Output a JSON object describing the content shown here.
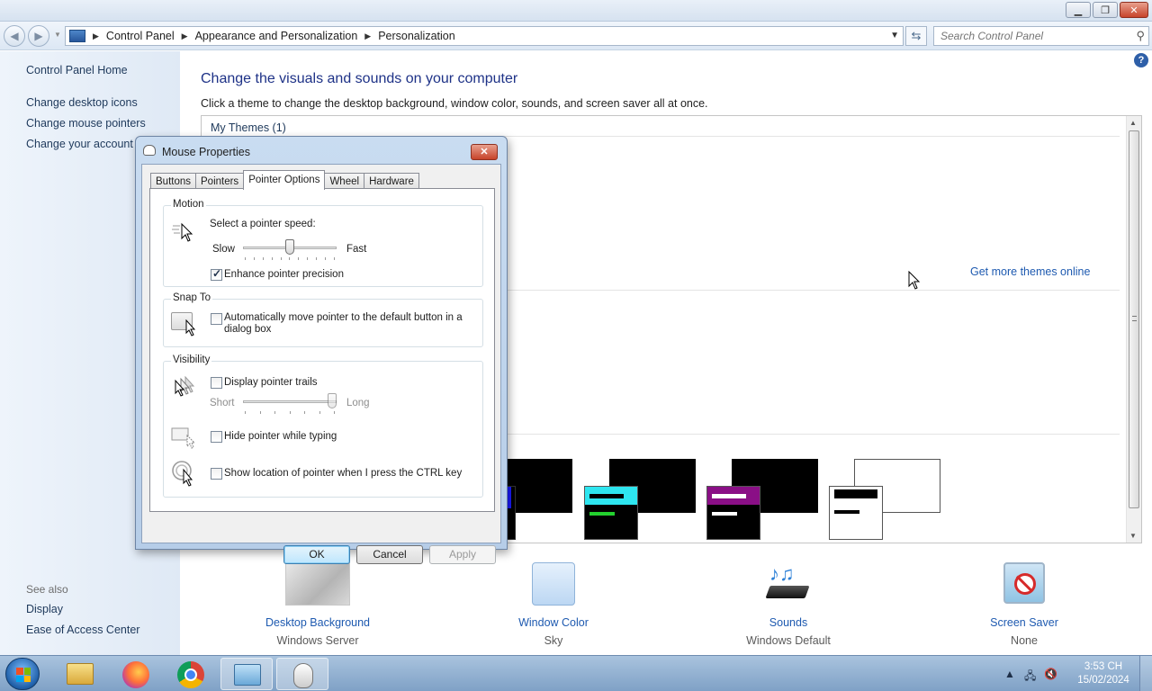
{
  "address": {
    "crumbs": [
      "Control Panel",
      "Appearance and Personalization",
      "Personalization"
    ],
    "search_placeholder": "Search Control Panel"
  },
  "sidebar": {
    "home": "Control Panel Home",
    "links": [
      "Change desktop icons",
      "Change mouse pointers",
      "Change your account p"
    ],
    "see_also_label": "See also",
    "see_also": [
      "Display",
      "Ease of Access Center"
    ]
  },
  "main": {
    "title": "Change the visuals and sounds on your computer",
    "description": "Click a theme to change the desktop background, window color, sounds, and screen saver all at once.",
    "my_themes": "My Themes (1)",
    "get_more": "Get more themes online"
  },
  "options": [
    {
      "label": "Desktop Background",
      "value": "Windows Server"
    },
    {
      "label": "Window Color",
      "value": "Sky"
    },
    {
      "label": "Sounds",
      "value": "Windows Default"
    },
    {
      "label": "Screen Saver",
      "value": "None"
    }
  ],
  "dialog": {
    "title": "Mouse Properties",
    "tabs": [
      "Buttons",
      "Pointers",
      "Pointer Options",
      "Wheel",
      "Hardware"
    ],
    "active_tab": "Pointer Options",
    "motion": {
      "group": "Motion",
      "prompt": "Select a pointer speed:",
      "slow": "Slow",
      "fast": "Fast",
      "speed_fraction": 0.5,
      "enhance": "Enhance pointer precision",
      "enhance_checked": true
    },
    "snap": {
      "group": "Snap To",
      "label_line1": "Automatically move pointer to the default button in a",
      "label_line2": "dialog box",
      "checked": false
    },
    "visibility": {
      "group": "Visibility",
      "trails": "Display pointer trails",
      "trails_checked": false,
      "short": "Short",
      "long": "Long",
      "trail_fraction": 1.0,
      "hide": "Hide pointer while typing",
      "hide_checked": false,
      "ctrl": "Show location of pointer when I press the CTRL key",
      "ctrl_checked": false
    },
    "buttons": {
      "ok": "OK",
      "cancel": "Cancel",
      "apply": "Apply"
    }
  },
  "taskbar": {
    "time": "3:53 CH",
    "date": "15/02/2024"
  },
  "colors": {
    "link": "#1e5ab0",
    "title": "#1e3287",
    "sidebar_bg": "#dfe9f5"
  }
}
